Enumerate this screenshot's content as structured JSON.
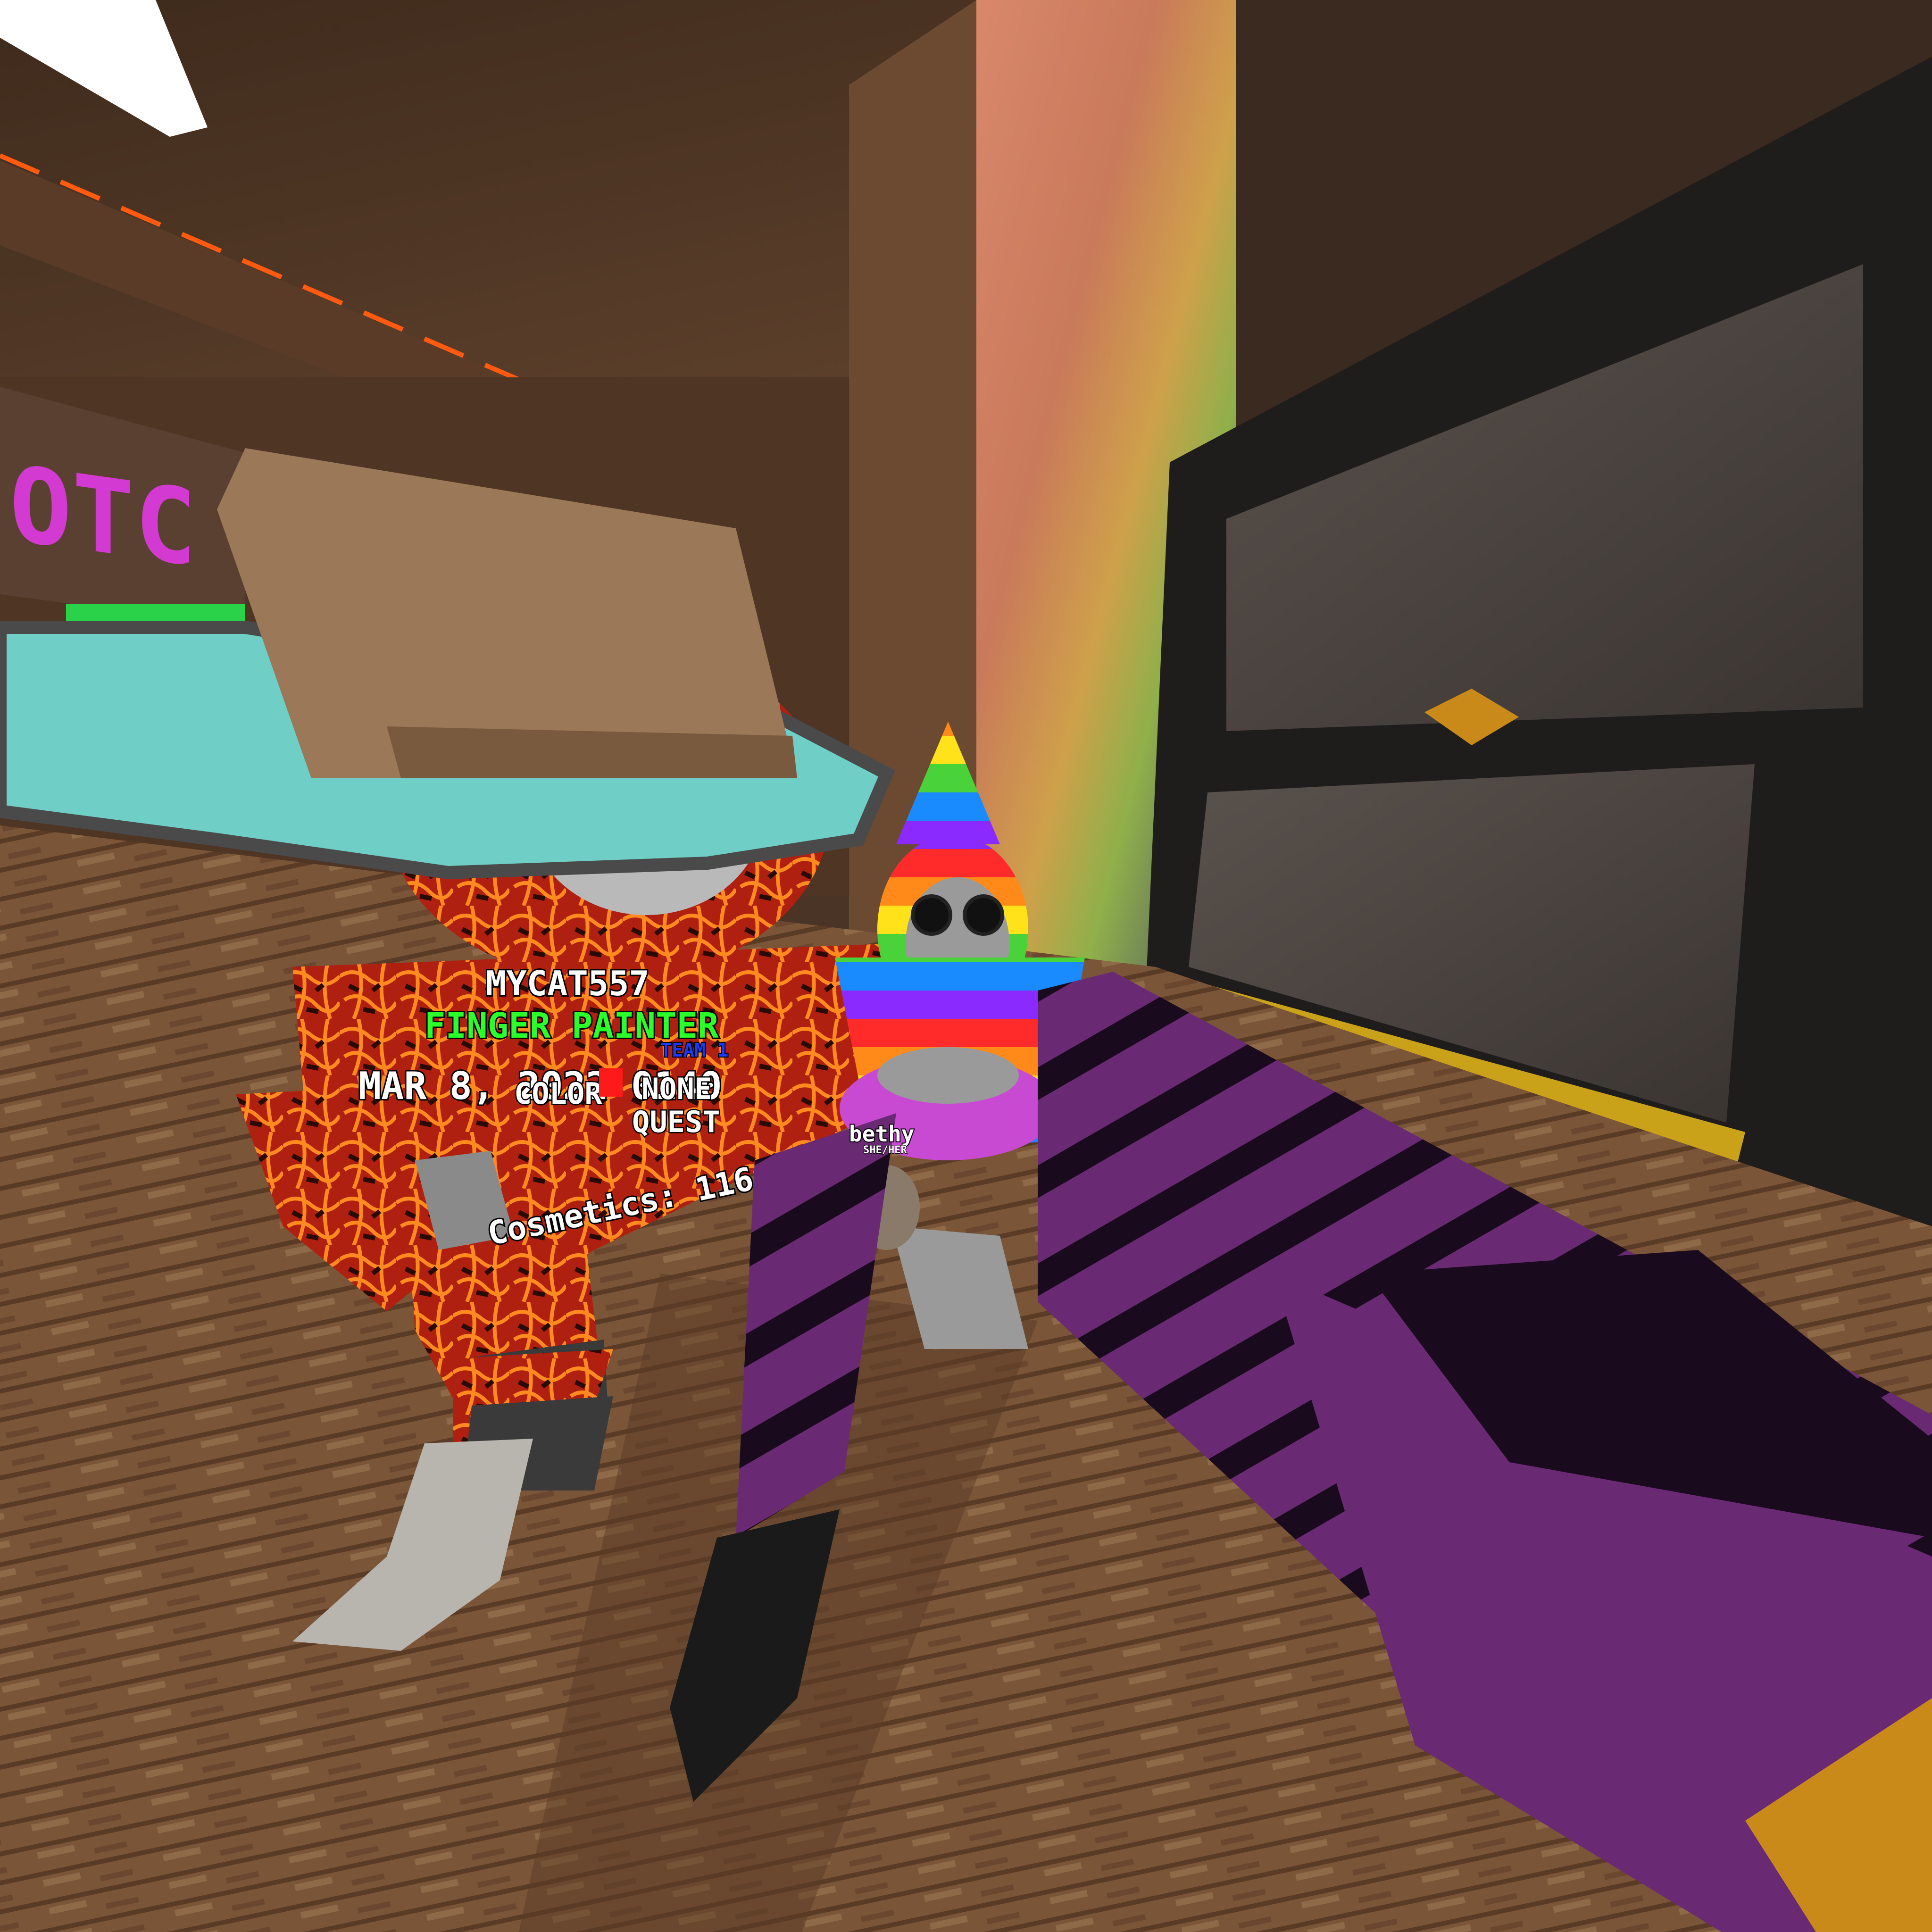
{
  "scene": {
    "colors": {
      "wood_dark": "#3a261a",
      "wood_mid": "#6b4a31",
      "wood_light": "#8a6747",
      "panel_dark": "#2c2a29",
      "panel_gray": "#4a4441",
      "lava_red": "#b42a12",
      "lava_orange": "#ff6a18",
      "cyan_brim": "#6fcfc6",
      "purple": "#6a2a73",
      "purple_dark": "#1a0a1e",
      "rainbow": [
        "#ff2a2a",
        "#ff8a1a",
        "#ffe21a",
        "#4ad23a",
        "#1a8aff",
        "#8a2aff"
      ],
      "text_white": "#ffffff",
      "text_green": "#2aff2a",
      "text_blue": "#1a3aff",
      "text_red": "#ff1a1a",
      "sign_magenta": "#d23ad2",
      "sign_green": "#2ad24a"
    },
    "icons": [
      "gorilla-avatar-lava",
      "gorilla-avatar-rainbow",
      "party-hat-icon",
      "cowboy-hat-icon",
      "player-arm",
      "sign-board"
    ]
  },
  "sign": {
    "text": "OTC"
  },
  "player_badge": {
    "name": "MYCAT557",
    "title": "FINGER PAINTER",
    "joined": "MAR 8, 2022 0140",
    "team": "TEAM 1",
    "color_label": "COLOR",
    "color_value": "NONE",
    "platform": "QUEST",
    "cosmetics": "Cosmetics: 116"
  },
  "nearby_player": {
    "name": "bethy",
    "pronouns": "SHE/HER"
  }
}
